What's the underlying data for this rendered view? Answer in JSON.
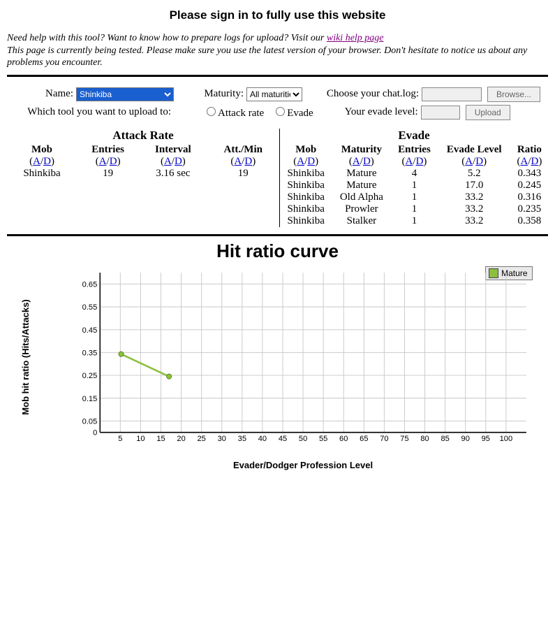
{
  "title": "Please sign in to fully use this website",
  "intro": {
    "line1_pre": "Need help with this tool? Want to know how to prepare logs for upload? Visit our ",
    "wiki_link": "wiki help page",
    "line2": "This page is currently being tested. Please make sure you use the latest version of your browser. Don't hesitate to notice us about any problems you encounter."
  },
  "form": {
    "name_label": "Name:",
    "name_value": "Shinkiba",
    "maturity_label": "Maturity:",
    "maturity_value": "All maturities",
    "chatlog_label": "Choose your chat.log:",
    "browse_btn": "Browse...",
    "which_tool_label": "Which tool you want to upload to:",
    "radio_attack": "Attack rate",
    "radio_evade": "Evade",
    "evade_level_label": "Your evade level:",
    "upload_btn": "Upload"
  },
  "sort": {
    "A": "A",
    "D": "D"
  },
  "attack_table": {
    "title": "Attack Rate",
    "headers": [
      "Mob",
      "Entries",
      "Interval",
      "Att./Min"
    ],
    "rows": [
      {
        "mob": "Shinkiba",
        "entries": "19",
        "interval": "3.16 sec",
        "attmin": "19"
      }
    ]
  },
  "evade_table": {
    "title": "Evade",
    "headers": [
      "Mob",
      "Maturity",
      "Entries",
      "Evade Level",
      "Ratio"
    ],
    "rows": [
      {
        "mob": "Shinkiba",
        "maturity": "Mature",
        "entries": "4",
        "level": "5.2",
        "ratio": "0.343"
      },
      {
        "mob": "Shinkiba",
        "maturity": "Mature",
        "entries": "1",
        "level": "17.0",
        "ratio": "0.245"
      },
      {
        "mob": "Shinkiba",
        "maturity": "Old Alpha",
        "entries": "1",
        "level": "33.2",
        "ratio": "0.316"
      },
      {
        "mob": "Shinkiba",
        "maturity": "Prowler",
        "entries": "1",
        "level": "33.2",
        "ratio": "0.235"
      },
      {
        "mob": "Shinkiba",
        "maturity": "Stalker",
        "entries": "1",
        "level": "33.2",
        "ratio": "0.358"
      }
    ]
  },
  "chart_data": {
    "type": "line",
    "title": "Hit ratio curve",
    "xlabel": "Evader/Dodger Profession Level",
    "ylabel": "Mob hit ratio (Hits/Attacks)",
    "x_ticks": [
      5,
      10,
      15,
      20,
      25,
      30,
      35,
      40,
      45,
      50,
      55,
      60,
      65,
      70,
      75,
      80,
      85,
      90,
      95,
      100
    ],
    "y_ticks": [
      0,
      0.05,
      0.15,
      0.25,
      0.35,
      0.45,
      0.55,
      0.65
    ],
    "xlim": [
      0,
      105
    ],
    "ylim": [
      0,
      0.7
    ],
    "series": [
      {
        "name": "Mature",
        "color": "#8cbf3f",
        "points": [
          {
            "x": 5.2,
            "y": 0.343
          },
          {
            "x": 17.0,
            "y": 0.245
          }
        ]
      }
    ]
  }
}
